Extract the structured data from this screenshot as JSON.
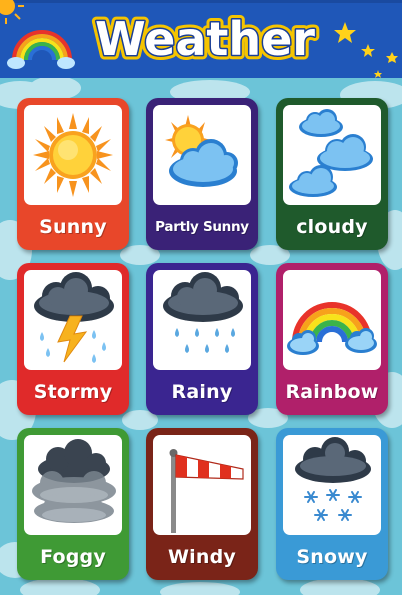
{
  "title": "Weather",
  "cards": [
    {
      "label": "Sunny",
      "color": "#e8472a",
      "icon": "sun-icon"
    },
    {
      "label": "Partly Sunny",
      "color": "#3a2277",
      "icon": "partly-sunny-icon"
    },
    {
      "label": "cloudy",
      "color": "#1f5a2c",
      "icon": "cloudy-icon"
    },
    {
      "label": "Stormy",
      "color": "#e02a2a",
      "icon": "storm-icon"
    },
    {
      "label": "Rainy",
      "color": "#3a2590",
      "icon": "rain-icon"
    },
    {
      "label": "Rainbow",
      "color": "#b0206a",
      "icon": "rainbow-icon"
    },
    {
      "label": "Foggy",
      "color": "#3f9a35",
      "icon": "fog-icon"
    },
    {
      "label": "Windy",
      "color": "#7a2418",
      "icon": "windsock-icon"
    },
    {
      "label": "Snowy",
      "color": "#3a9ad6",
      "icon": "snow-icon"
    }
  ],
  "colors": {
    "header": "#1f57b8",
    "background": "#6cc4d8",
    "title_fill": "#ffffff",
    "title_outline": "#1a3f96"
  }
}
